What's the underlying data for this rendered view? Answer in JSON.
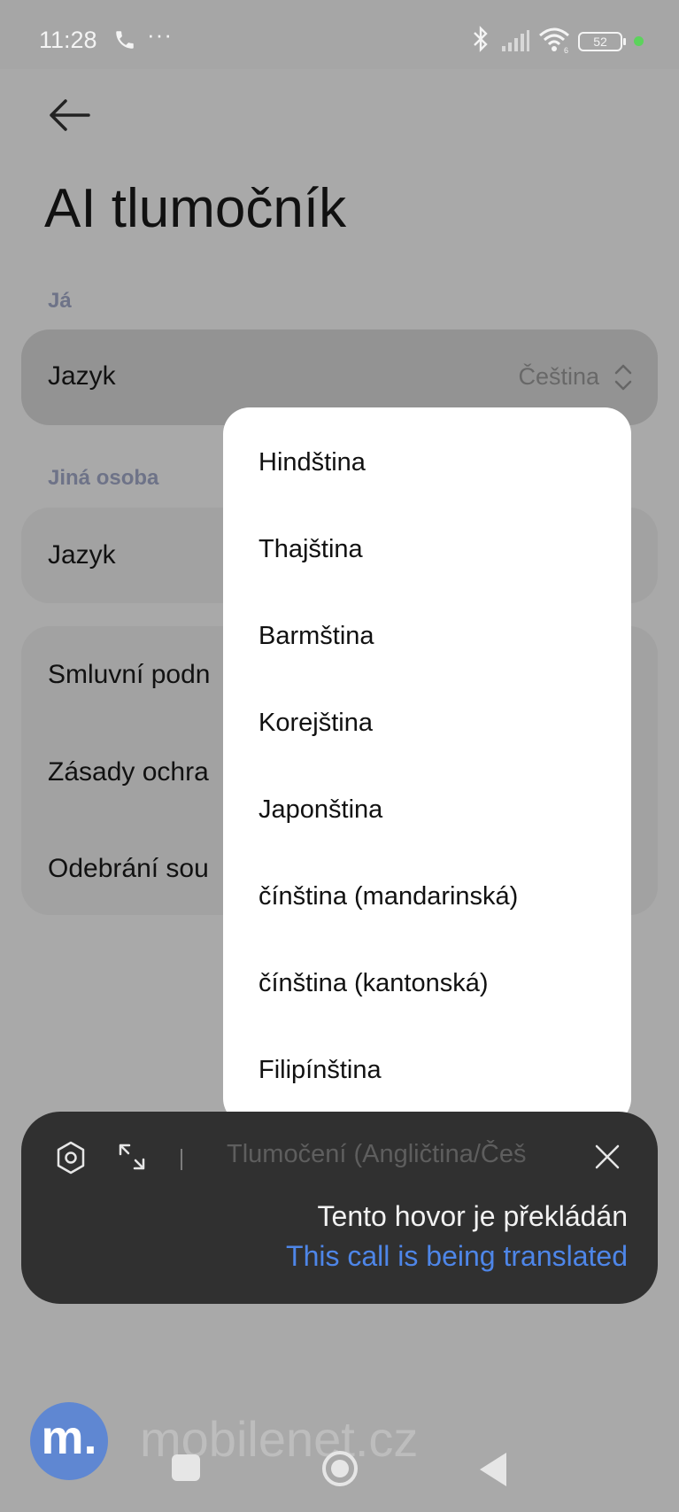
{
  "status_bar": {
    "time": "11:28",
    "extra": "···",
    "battery": "52",
    "wifi_band": "6"
  },
  "page": {
    "title": "AI tlumočník"
  },
  "me_section": {
    "label": "Já",
    "language_label": "Jazyk",
    "language_value": "Čeština"
  },
  "other_section": {
    "label": "Jiná osoba",
    "language_label": "Jazyk"
  },
  "links": [
    "Smluvní podn",
    "Zásady ochra",
    "Odebrání sou"
  ],
  "dropdown": {
    "options": [
      "Hindština",
      "Thajština",
      "Barmština",
      "Korejština",
      "Japonština",
      "čínština (mandarinská)",
      "čínština (kantonská)",
      "Filipínština"
    ]
  },
  "translation_overlay": {
    "caption": "Tlumočení (Angličtina/Češ",
    "message_cs": "Tento hovor je překládán",
    "message_en": "This call is being translated"
  },
  "watermark": {
    "logo_letter": "m.",
    "text": "mobilenet.cz"
  }
}
